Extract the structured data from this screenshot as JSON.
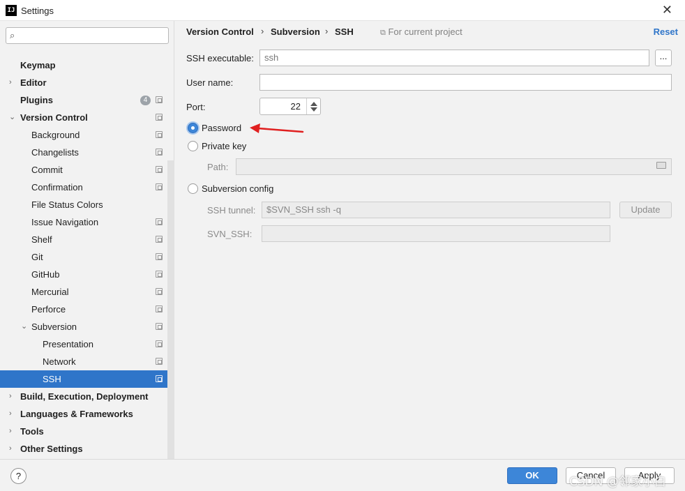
{
  "window": {
    "title": "Settings",
    "logo_text": "IJ"
  },
  "sidebar": {
    "search_placeholder": "",
    "items": [
      {
        "label": "Keymap"
      },
      {
        "label": "Editor"
      },
      {
        "label": "Plugins",
        "badge": "4"
      },
      {
        "label": "Version Control"
      },
      {
        "label": "Background"
      },
      {
        "label": "Changelists"
      },
      {
        "label": "Commit"
      },
      {
        "label": "Confirmation"
      },
      {
        "label": "File Status Colors"
      },
      {
        "label": "Issue Navigation"
      },
      {
        "label": "Shelf"
      },
      {
        "label": "Git"
      },
      {
        "label": "GitHub"
      },
      {
        "label": "Mercurial"
      },
      {
        "label": "Perforce"
      },
      {
        "label": "Subversion"
      },
      {
        "label": "Presentation"
      },
      {
        "label": "Network"
      },
      {
        "label": "SSH"
      },
      {
        "label": "Build, Execution, Deployment"
      },
      {
        "label": "Languages & Frameworks"
      },
      {
        "label": "Tools"
      },
      {
        "label": "Other Settings"
      }
    ]
  },
  "breadcrumb": {
    "parts": [
      "Version Control",
      "Subversion",
      "SSH"
    ],
    "separator": "›",
    "scope": "For current project",
    "reset_label": "Reset"
  },
  "form": {
    "ssh_executable_label": "SSH executable:",
    "ssh_executable_value": "ssh",
    "browse_label": "...",
    "user_name_label": "User name:",
    "user_name_value": "",
    "port_label": "Port:",
    "port_value": "22",
    "password_label": "Password",
    "private_key_label": "Private key",
    "path_label": "Path:",
    "path_value": "",
    "subversion_config_label": "Subversion config",
    "ssh_tunnel_label": "SSH tunnel:",
    "ssh_tunnel_value": "$SVN_SSH ssh -q",
    "update_label": "Update",
    "svn_ssh_label": "SVN_SSH:",
    "svn_ssh_value": ""
  },
  "footer": {
    "help_label": "?",
    "ok_label": "OK",
    "cancel_label": "Cancel",
    "apply_label": "Apply",
    "watermark": "CSDN @邻家小白"
  },
  "colors": {
    "accent": "#2f75c9",
    "annotation_arrow": "#e02020"
  }
}
